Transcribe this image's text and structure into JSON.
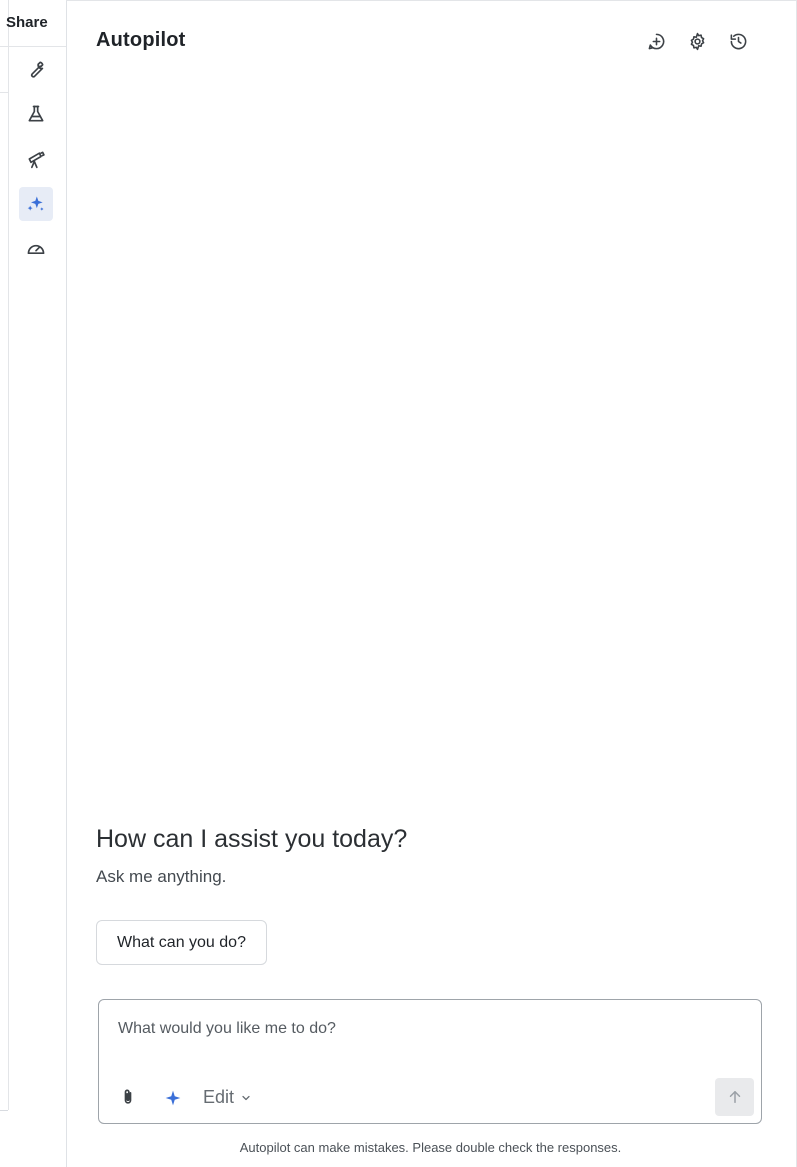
{
  "app": {
    "share_label": "Share",
    "title": "Autopilot"
  },
  "toolstrip": [
    {
      "name": "wrench-icon",
      "active": false
    },
    {
      "name": "flask-icon",
      "active": false
    },
    {
      "name": "telescope-icon",
      "active": false
    },
    {
      "name": "sparkles-icon",
      "active": true
    },
    {
      "name": "gauge-icon",
      "active": false
    }
  ],
  "header_icons": [
    "new-chat-icon",
    "settings-gear-icon",
    "history-icon"
  ],
  "welcome": {
    "heading": "How can I assist you today?",
    "subheading": "Ask me anything.",
    "suggestion": "What can you do?"
  },
  "composer": {
    "placeholder": "What would you like me to do?",
    "mode": "Edit"
  },
  "footer": {
    "disclaimer": "Autopilot can make mistakes. Please double check the responses."
  },
  "colors": {
    "accent": "#3a6fd8",
    "icon": "#3c4146",
    "active_bg": "#e7ecf6"
  }
}
